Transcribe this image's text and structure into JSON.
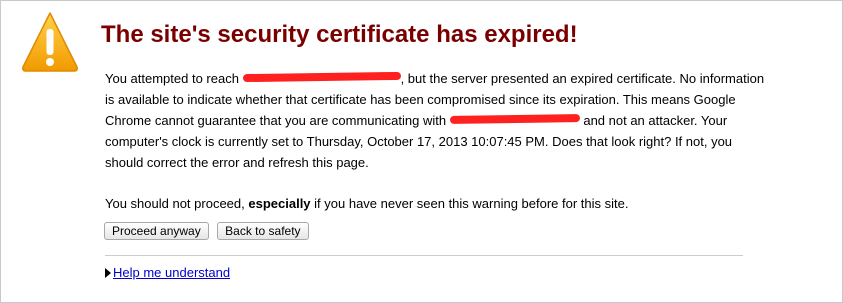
{
  "page": {
    "title": "The site's security certificate has expired!",
    "para1_a": "You attempted to reach",
    "para1_b": ", but the server presented an expired certificate. No information is available to indicate whether that certificate has been compromised since its expiration. This means Google Chrome cannot guarantee that you are communicating with",
    "para1_c": "and not an attacker. Your computer's clock is currently set to Thursday, October 17, 2013 10:07:45 PM. Does that look right? If not, you should correct the error and refresh this page.",
    "para2_a": "You should not proceed,",
    "para2_bold": "especially",
    "para2_b": "if you have never seen this warning before for this site."
  },
  "buttons": {
    "proceed": "Proceed anyway",
    "back": "Back to safety"
  },
  "help": {
    "label": "Help me understand"
  },
  "icons": {
    "warning": "warning-triangle-icon",
    "disclosure": "disclosure-triangle-icon"
  },
  "colors": {
    "title": "#7a0000",
    "warning_fill": "#f5a300",
    "link": "#0000cc",
    "redaction": "#ff2020"
  }
}
